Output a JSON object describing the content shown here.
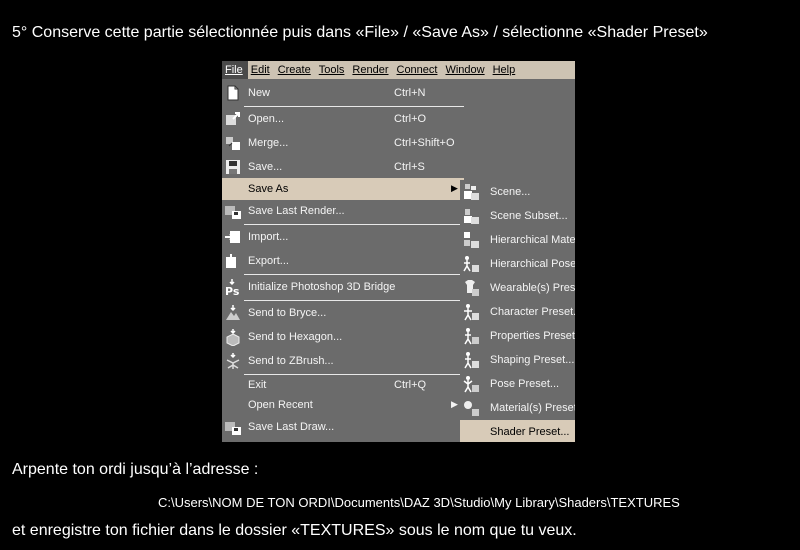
{
  "caption": {
    "step": "5° Conserve cette partie sélectionnée puis dans «File» / «Save As» / sélectionne «Shader Preset»",
    "line1": "Arpente ton ordi jusqu’à l’adresse :",
    "path": "C:\\Users\\NOM DE TON ORDI\\Documents\\DAZ 3D\\Studio\\My Library\\Shaders\\TEXTURES",
    "line3": "et enregistre ton fichier dans le dossier «TEXTURES» sous le nom que tu veux."
  },
  "menubar": [
    "File",
    "Edit",
    "Create",
    "Tools",
    "Render",
    "Connect",
    "Window",
    "Help"
  ],
  "file_menu": [
    {
      "label": "New",
      "shortcut": "Ctrl+N",
      "icon": "new-file-icon"
    },
    {
      "label": "Open...",
      "shortcut": "Ctrl+O",
      "icon": "open-icon"
    },
    {
      "label": "Merge...",
      "shortcut": "Ctrl+Shift+O",
      "icon": "merge-icon"
    },
    {
      "label": "Save...",
      "shortcut": "Ctrl+S",
      "icon": "save-disk-icon"
    },
    {
      "label": "Save As",
      "shortcut": "",
      "icon": "",
      "submenu": true,
      "selected": true
    },
    {
      "label": "Save Last Render...",
      "shortcut": "",
      "icon": "save-render-icon"
    },
    {
      "label": "Import...",
      "shortcut": "",
      "icon": "import-icon"
    },
    {
      "label": "Export...",
      "shortcut": "",
      "icon": "export-icon"
    },
    {
      "label": "Initialize Photoshop 3D Bridge",
      "shortcut": "",
      "icon": "photoshop-icon"
    },
    {
      "label": "Send to Bryce...",
      "shortcut": "",
      "icon": "bryce-icon"
    },
    {
      "label": "Send to Hexagon...",
      "shortcut": "",
      "icon": "hexagon-icon"
    },
    {
      "label": "Send to ZBrush...",
      "shortcut": "",
      "icon": "zbrush-icon"
    },
    {
      "label": "Exit",
      "shortcut": "Ctrl+Q",
      "icon": ""
    },
    {
      "label": "Open Recent",
      "shortcut": "",
      "icon": "",
      "submenu": true
    },
    {
      "label": "Save Last Draw...",
      "shortcut": "",
      "icon": "save-draw-icon"
    }
  ],
  "save_as_menu": [
    {
      "label": "Scene...",
      "icon": "scene-preset-icon"
    },
    {
      "label": "Scene Subset...",
      "icon": "scene-subset-icon"
    },
    {
      "label": "Hierarchical Material(s) Preset...",
      "icon": "hier-material-icon"
    },
    {
      "label": "Hierarchical Pose Preset...",
      "icon": "hier-pose-icon"
    },
    {
      "label": "Wearable(s) Preset...",
      "icon": "wearable-icon"
    },
    {
      "label": "Character Preset...",
      "icon": "character-icon"
    },
    {
      "label": "Properties Preset...",
      "icon": "properties-icon"
    },
    {
      "label": "Shaping Preset...",
      "icon": "shaping-icon"
    },
    {
      "label": "Pose Preset...",
      "icon": "pose-icon"
    },
    {
      "label": "Material(s) Preset...",
      "icon": "material-icon"
    },
    {
      "label": "Shader Preset...",
      "icon": "",
      "selected": true
    }
  ],
  "colors": {
    "background": "#000000",
    "menu_bg": "#6b6b6b",
    "menubar_bg": "#cdc3b3",
    "highlight": "#d8cbb8",
    "text": "#ffffff"
  }
}
